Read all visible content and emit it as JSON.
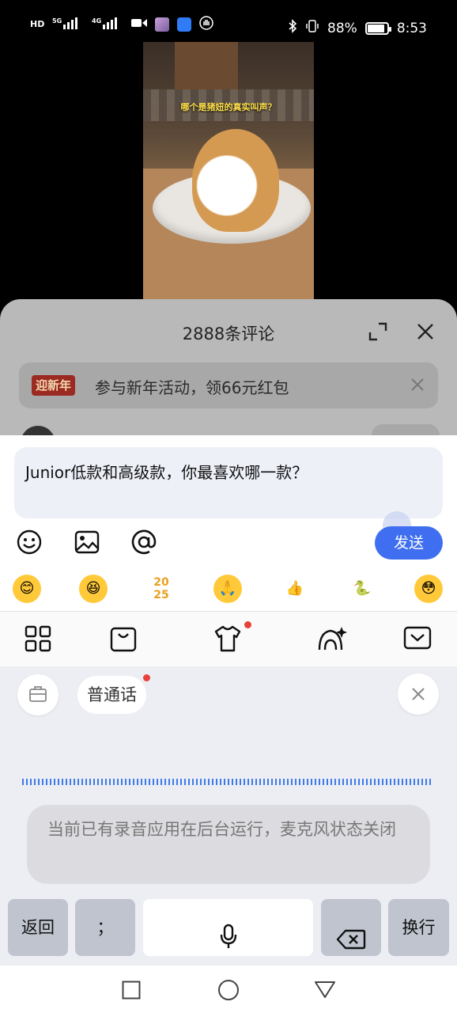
{
  "status_bar": {
    "battery": "88%",
    "time": "8:53",
    "network": [
      "HD",
      "5G",
      "4G"
    ]
  },
  "video": {
    "caption": "哪个是猪妞的真实叫声？"
  },
  "comments": {
    "title": "2888条评论",
    "banner_badge": "迎新年",
    "banner_text": "参与新年活动，领66元红包"
  },
  "input": {
    "text": "Junior低款和高级款，你最喜欢哪一款？",
    "send_label": "发送"
  },
  "emojis": [
    "grin-emoji",
    "laugh-emoji",
    "2025-emoji",
    "pray-emoji",
    "thumbs-up-emoji",
    "snake-emoji",
    "shy-emoji"
  ],
  "voice": {
    "lang_label": "普通话",
    "notice": "当前已有录音应用在后台运行，麦克风状态关闭"
  },
  "keyboard": {
    "back": "返回",
    "semicolon": "；",
    "newline": "换行"
  },
  "colors": {
    "accent": "#3f6ff0",
    "wave": "#3f7be8",
    "badge": "#9a2a22"
  }
}
